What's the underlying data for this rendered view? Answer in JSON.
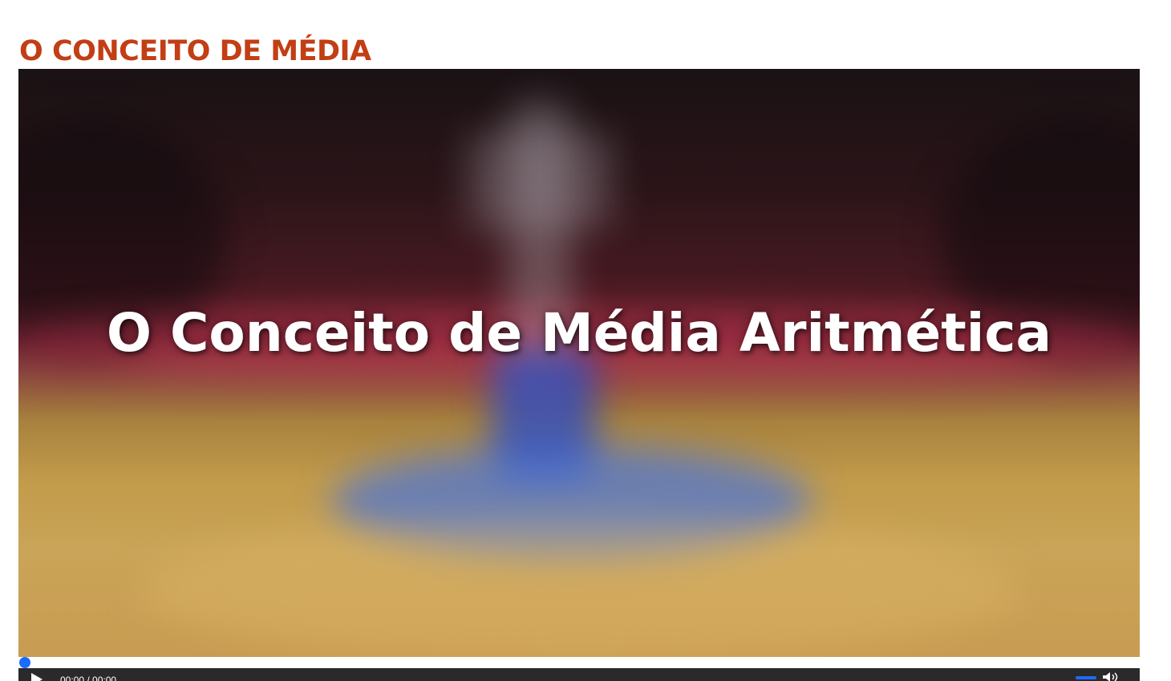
{
  "page": {
    "title": "O CONCEITO DE MÉDIA"
  },
  "video": {
    "caption": "O Conceito de Média Aritmética",
    "time_display": "00:00 / 00:00",
    "progress": 0,
    "icons": {
      "play": "play-icon",
      "volume": "volume-icon"
    },
    "colors": {
      "accent": "#1a6cff",
      "controls_bg": "#2a2a2a"
    }
  },
  "colors": {
    "title": "#c23e14"
  }
}
